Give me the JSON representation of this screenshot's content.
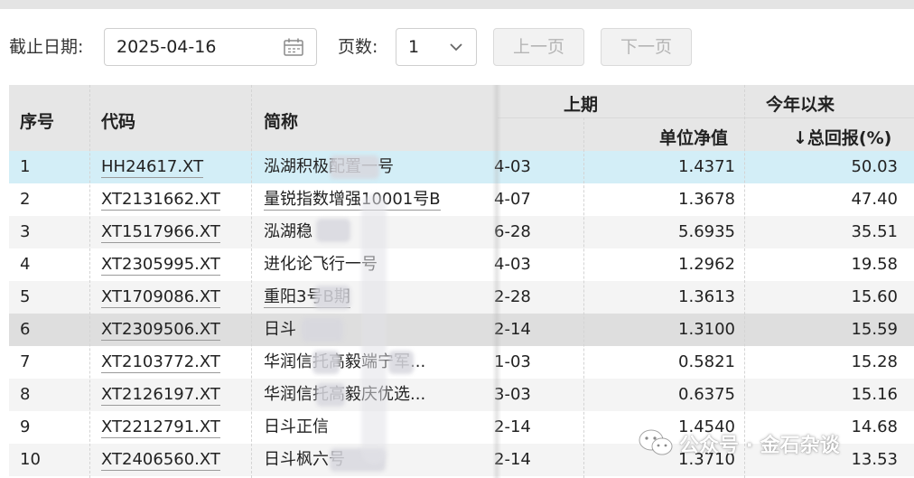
{
  "toolbar": {
    "date_label": "截止日期:",
    "date_value": "2025-04-16",
    "page_label": "页数:",
    "page_value": "1",
    "prev_label": "上一页",
    "next_label": "下一页"
  },
  "table": {
    "headers": {
      "seq": "序号",
      "code": "代码",
      "name": "简称",
      "group_last": "上期",
      "nav": "单位净值",
      "group_ytd": "今年以来",
      "total_return": "↓总回报(%)"
    },
    "rows": [
      {
        "seq": "1",
        "code": "HH24617.XT",
        "name": "泓湖积极配置一号",
        "date": "4-03",
        "nav": "1.4371",
        "ret": "50.03"
      },
      {
        "seq": "2",
        "code": "XT2131662.XT",
        "name": "量锐指数增强10001号B",
        "date": "4-07",
        "nav": "1.3678",
        "ret": "47.40"
      },
      {
        "seq": "3",
        "code": "XT1517966.XT",
        "name": "泓湖稳",
        "date": "6-28",
        "nav": "5.6935",
        "ret": "35.51"
      },
      {
        "seq": "4",
        "code": "XT2305995.XT",
        "name": "进化论飞行一号",
        "date": "4-03",
        "nav": "1.2962",
        "ret": "19.58"
      },
      {
        "seq": "5",
        "code": "XT1709086.XT",
        "name": "重阳3号B期",
        "date": "2-28",
        "nav": "1.3613",
        "ret": "15.60"
      },
      {
        "seq": "6",
        "code": "XT2309506.XT",
        "name": "日斗",
        "date": "2-14",
        "nav": "1.3100",
        "ret": "15.59"
      },
      {
        "seq": "7",
        "code": "XT2103772.XT",
        "name": "华润信托高毅端宁军...",
        "date": "1-03",
        "nav": "0.5821",
        "ret": "15.28"
      },
      {
        "seq": "8",
        "code": "XT2126197.XT",
        "name": "华润信托高毅庆优选...",
        "date": "3-03",
        "nav": "0.6375",
        "ret": "15.16"
      },
      {
        "seq": "9",
        "code": "XT2212791.XT",
        "name": "日斗正信",
        "date": "2-14",
        "nav": "1.4540",
        "ret": "14.68"
      },
      {
        "seq": "10",
        "code": "XT2406560.XT",
        "name": "日斗枫六号",
        "date": "2-14",
        "nav": "1.3710",
        "ret": "13.53"
      }
    ]
  },
  "watermark": {
    "text": "公众号 · 金石杂谈"
  }
}
